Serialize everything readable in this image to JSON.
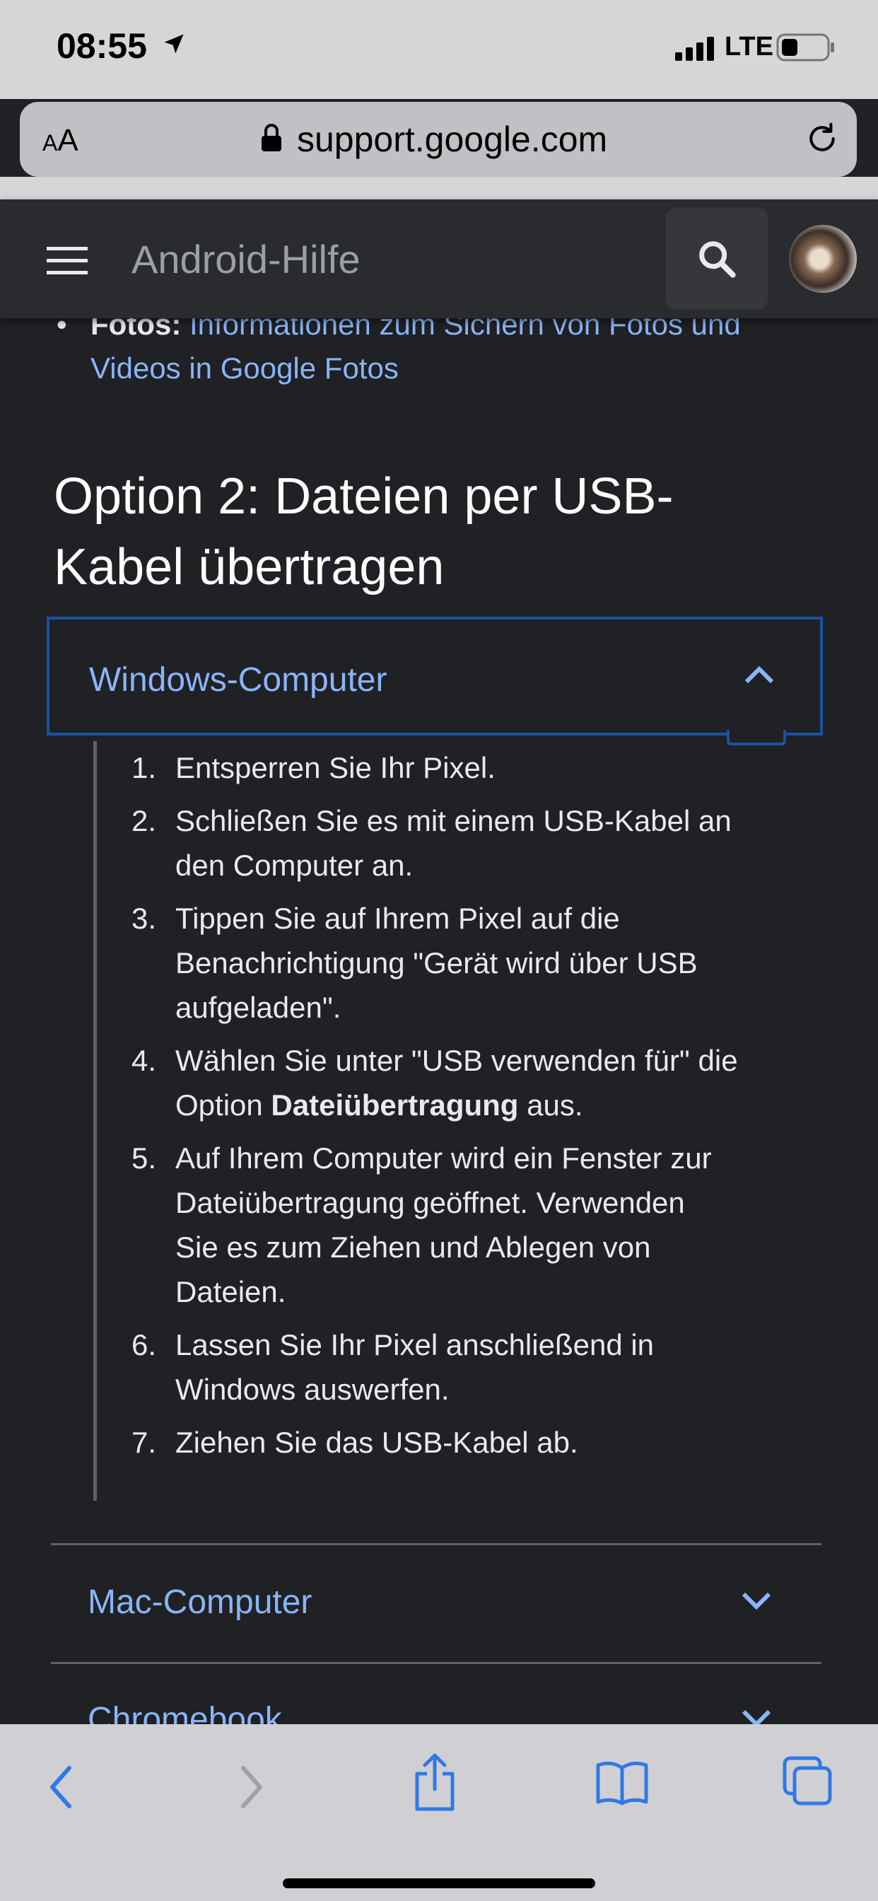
{
  "status_bar": {
    "time": "08:55",
    "network": "LTE"
  },
  "address_bar": {
    "text_size_label_small": "A",
    "text_size_label_large": "A",
    "url": "support.google.com"
  },
  "header": {
    "title": "Android-Hilfe"
  },
  "previous_item": {
    "bullet": "•",
    "label": "Fotos",
    "colon": ":",
    "link_line1": "Informationen zum Sichern von Fotos und",
    "link_line2": "Videos in Google Fotos"
  },
  "section": {
    "title_line1": "Option 2: Dateien per USB-",
    "title_line2": "Kabel übertragen"
  },
  "accordions": [
    {
      "label": "Windows-Computer",
      "expanded": true,
      "steps": [
        {
          "num": "1.",
          "lines": [
            "Entsperren Sie Ihr Pixel."
          ]
        },
        {
          "num": "2.",
          "lines": [
            "Schließen Sie es mit einem USB-Kabel an",
            "den Computer an."
          ]
        },
        {
          "num": "3.",
          "lines": [
            "Tippen Sie auf Ihrem Pixel auf die",
            "Benachrichtigung \"Gerät wird über USB",
            "aufgeladen\"."
          ]
        },
        {
          "num": "4.",
          "lines": [
            "Wählen Sie unter \"USB verwenden für\" die"
          ],
          "pre_bold": "Option ",
          "bold": "Dateiübertragung",
          "post_bold": " aus."
        },
        {
          "num": "5.",
          "lines": [
            "Auf Ihrem Computer wird ein Fenster zur",
            "Dateiübertragung geöffnet. Verwenden",
            "Sie es zum Ziehen und Ablegen von",
            "Dateien."
          ]
        },
        {
          "num": "6.",
          "lines": [
            "Lassen Sie Ihr Pixel anschließend in",
            "Windows auswerfen."
          ]
        },
        {
          "num": "7.",
          "lines": [
            "Ziehen Sie das USB-Kabel ab."
          ]
        }
      ]
    },
    {
      "label": "Mac-Computer",
      "expanded": false
    },
    {
      "label": "Chromebook",
      "expanded": false
    }
  ],
  "toolbar": {
    "items": [
      "back-icon",
      "forward-icon",
      "share-icon",
      "bookmarks-icon",
      "tabs-icon"
    ]
  },
  "colors": {
    "link": "#8ab4f8",
    "background": "#202124",
    "focus_border": "#1a52a5"
  }
}
